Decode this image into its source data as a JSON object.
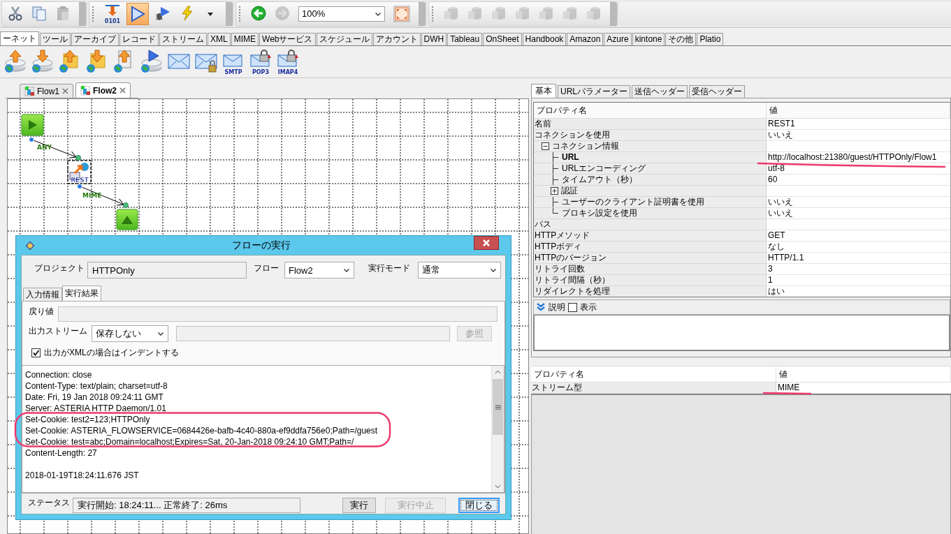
{
  "toolbar": {
    "groups": [
      {
        "items": [
          {
            "kind": "cut",
            "disabled": false,
            "pressed": false
          },
          {
            "kind": "copy",
            "disabled": false,
            "pressed": false
          },
          {
            "kind": "paste",
            "disabled": true,
            "pressed": false
          }
        ]
      },
      {
        "items": [
          {
            "kind": "compile",
            "label": "0101",
            "disabled": false,
            "pressed": false
          },
          {
            "kind": "run",
            "disabled": false,
            "pressed": true
          },
          {
            "kind": "debug",
            "disabled": false,
            "pressed": false
          },
          {
            "kind": "trigger",
            "disabled": false,
            "pressed": false
          },
          {
            "kind": "menu",
            "disabled": false,
            "pressed": false
          }
        ]
      },
      {
        "items": [
          {
            "kind": "back",
            "disabled": false,
            "pressed": false
          },
          {
            "kind": "forward",
            "disabled": true,
            "pressed": false
          },
          {
            "kind": "zoom",
            "value": "100%"
          },
          {
            "kind": "fit",
            "disabled": false,
            "pressed": false
          }
        ]
      },
      {
        "items": [
          {
            "kind": "database",
            "disabled": true,
            "pressed": false
          },
          {
            "kind": "database",
            "disabled": true,
            "pressed": false
          },
          {
            "kind": "database",
            "disabled": true,
            "pressed": false
          },
          {
            "kind": "database",
            "disabled": true,
            "pressed": false
          },
          {
            "kind": "database",
            "disabled": true,
            "pressed": false
          },
          {
            "kind": "database",
            "disabled": true,
            "pressed": false
          },
          {
            "kind": "database",
            "disabled": true,
            "pressed": false
          }
        ]
      }
    ]
  },
  "palette_tabs": [
    {
      "label": "ーネット",
      "selected": true
    },
    {
      "label": "ツール",
      "selected": false
    },
    {
      "label": "アーカイブ",
      "selected": false
    },
    {
      "label": "レコード",
      "selected": false
    },
    {
      "label": "ストリーム",
      "selected": false
    },
    {
      "label": "XML",
      "selected": false
    },
    {
      "label": "MIME",
      "selected": false
    },
    {
      "label": "Webサービス",
      "selected": false
    },
    {
      "label": "スケジュール",
      "selected": false
    },
    {
      "label": "アカウント",
      "selected": false
    },
    {
      "label": "DWH",
      "selected": false
    },
    {
      "label": "Tableau",
      "selected": false
    },
    {
      "label": "OnSheet",
      "selected": false
    },
    {
      "label": "Handbook",
      "selected": false
    },
    {
      "label": "Amazon",
      "selected": false
    },
    {
      "label": "Azure",
      "selected": false
    },
    {
      "label": "kintone",
      "selected": false
    },
    {
      "label": "その他",
      "selected": false
    },
    {
      "label": "Platio",
      "selected": false
    }
  ],
  "palette": [
    {
      "kind": "globe-upload"
    },
    {
      "kind": "globe-download"
    },
    {
      "kind": "folder-upload"
    },
    {
      "kind": "folder-download"
    },
    {
      "kind": "file-upload"
    },
    {
      "kind": "globe-send"
    },
    {
      "kind": "mail"
    },
    {
      "kind": "mail-lock"
    },
    {
      "kind": "mail-send",
      "label": "SMTP"
    },
    {
      "kind": "mail-receive",
      "label": "POP3"
    },
    {
      "kind": "mail-receive",
      "label": "IMAP4"
    }
  ],
  "editor_tabs": [
    {
      "label": "Flow1",
      "selected": false
    },
    {
      "label": "Flow2",
      "selected": true
    }
  ],
  "flow": {
    "nodes": [
      {
        "kind": "start"
      },
      {
        "kind": "rest",
        "label": "REST",
        "selected": true
      },
      {
        "kind": "end"
      }
    ],
    "connectors": [
      {
        "label": "ANY"
      },
      {
        "label": "MIME"
      }
    ]
  },
  "dialog": {
    "title": "フローの実行",
    "fields": [
      {
        "kind": "text",
        "label": "プロジェクト",
        "value": "HTTPOnly"
      },
      {
        "kind": "select",
        "label": "フロー",
        "value": "Flow2"
      },
      {
        "kind": "select",
        "label": "実行モード",
        "value": "通常"
      }
    ],
    "tabs": [
      {
        "label": "入力情報",
        "selected": false
      },
      {
        "label": "実行結果",
        "selected": true
      }
    ],
    "return_value": {
      "label": "戻り値",
      "disabled": true
    },
    "output_stream": {
      "label": "出力ストリーム",
      "value": "保存しない",
      "browse": {
        "label": "参照",
        "disabled": true
      }
    },
    "indent_xml": {
      "label": "出力がXMLの場合はインデントする",
      "checked": true
    },
    "output_blocks": [
      [
        "Connection: close",
        "Content-Type: text/plain; charset=utf-8",
        "Date: Fri, 19 Jan 2018 09:24:11 GMT",
        "Server: ASTERIA HTTP Daemon/1.01",
        "Set-Cookie: test2=123;HTTPOnly",
        "Set-Cookie: ASTERIA_FLOWSERVICE=0684426e-bafb-4c40-880a-ef9ddfa756e0;Path=/guest",
        "Set-Cookie: test=abc;Domain=localhost;Expires=Sat, 20-Jan-2018 09:24:10 GMT;Path=/",
        "Content-Length: 27"
      ],
      [
        "2018-01-19T18:24:11.676 JST"
      ]
    ],
    "status": {
      "label": "ステータス",
      "value": "実行開始: 18:24:11... 正常終了: 26ms"
    },
    "buttons": [
      {
        "label": "実行",
        "disabled": false,
        "default": false
      },
      {
        "label": "実行中止",
        "disabled": true,
        "default": false
      },
      {
        "label": "閉じる",
        "disabled": false,
        "default": true
      }
    ]
  },
  "properties": {
    "tabs": [
      {
        "label": "基本",
        "selected": true
      },
      {
        "label": "URLパラメーター",
        "selected": false
      },
      {
        "label": "送信ヘッダー",
        "selected": false
      },
      {
        "label": "受信ヘッダー",
        "selected": false
      }
    ],
    "columns": [
      "プロパティ名",
      "値"
    ],
    "rows": [
      {
        "name": "名前",
        "value": "REST1",
        "bold": false
      },
      {
        "name": "コネクションを使用",
        "value": "いいえ",
        "bold": false
      },
      {
        "name": "コネクション情報",
        "bold": false,
        "expanded": true,
        "children": [
          {
            "name": "URL",
            "value": "http://localhost:21380/guest/HTTPOnly/Flow1",
            "bold": true
          },
          {
            "name": "URLエンコーディング",
            "value": "utf-8",
            "bold": false
          },
          {
            "name": "タイムアウト（秒）",
            "value": "60",
            "bold": false
          },
          {
            "name": "認証",
            "bold": false,
            "expanded": false
          },
          {
            "name": "ユーザーのクライアント証明書を使用",
            "value": "いいえ",
            "bold": false
          },
          {
            "name": "プロキシ設定を使用",
            "value": "いいえ",
            "bold": false
          }
        ]
      },
      {
        "name": "パス",
        "bold": false
      },
      {
        "name": "HTTPメソッド",
        "value": "GET",
        "bold": false
      },
      {
        "name": "HTTPボディ",
        "value": "なし",
        "bold": false
      },
      {
        "name": "HTTPのバージョン",
        "value": "HTTP/1.1",
        "bold": false
      },
      {
        "name": "リトライ回数",
        "value": "3",
        "bold": false
      },
      {
        "name": "リトライ間隔（秒）",
        "value": "1",
        "bold": false
      },
      {
        "name": "リダイレクトを処理",
        "value": "はい",
        "bold": false
      }
    ]
  },
  "description": {
    "label": "説明",
    "checkbox": {
      "label": "表示",
      "checked": false
    }
  },
  "stream_properties": {
    "columns": [
      "プロパティ名",
      "値"
    ],
    "rows": [
      {
        "name": "ストリーム型",
        "value": "MIME"
      }
    ]
  }
}
